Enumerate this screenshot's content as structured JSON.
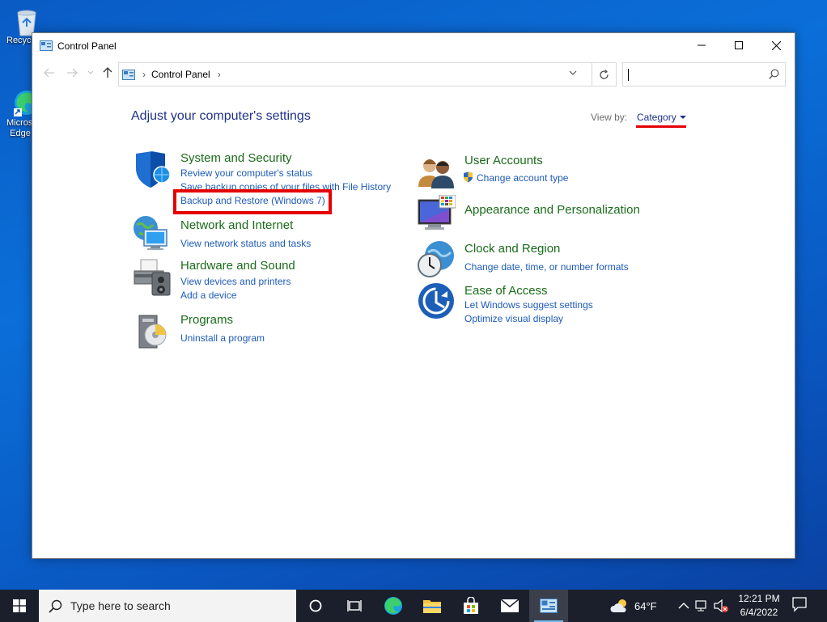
{
  "desktop": {
    "icons": [
      {
        "label": "Recycle Bin"
      },
      {
        "label": "Microsoft Edge"
      }
    ]
  },
  "window": {
    "title": "Control Panel",
    "address": {
      "crumbs": [
        "Control Panel"
      ]
    },
    "search": {
      "placeholder": "",
      "value": ""
    },
    "heading": "Adjust your computer's settings",
    "view_by": {
      "label": "View by:",
      "value": "Category"
    },
    "categories": [
      {
        "title": "System and Security",
        "links": [
          "Review your computer's status",
          "Save backup copies of your files with File History",
          "Backup and Restore (Windows 7)"
        ]
      },
      {
        "title": "Network and Internet",
        "links": [
          "View network status and tasks"
        ]
      },
      {
        "title": "Hardware and Sound",
        "links": [
          "View devices and printers",
          "Add a device"
        ]
      },
      {
        "title": "Programs",
        "links": [
          "Uninstall a program"
        ]
      },
      {
        "title": "User Accounts",
        "links": [
          "Change account type"
        ]
      },
      {
        "title": "Appearance and Personalization",
        "links": []
      },
      {
        "title": "Clock and Region",
        "links": [
          "Change date, time, or number formats"
        ]
      },
      {
        "title": "Ease of Access",
        "links": [
          "Let Windows suggest settings",
          "Optimize visual display"
        ]
      }
    ]
  },
  "taskbar": {
    "search_placeholder": "Type here to search",
    "weather": "64°F",
    "time": "12:21 PM",
    "date": "6/4/2022"
  },
  "colors": {
    "accent_red": "#e50000",
    "link_blue": "#1e5bb8",
    "category_green": "#1a6b1a",
    "heading_navy": "#1e3287"
  }
}
